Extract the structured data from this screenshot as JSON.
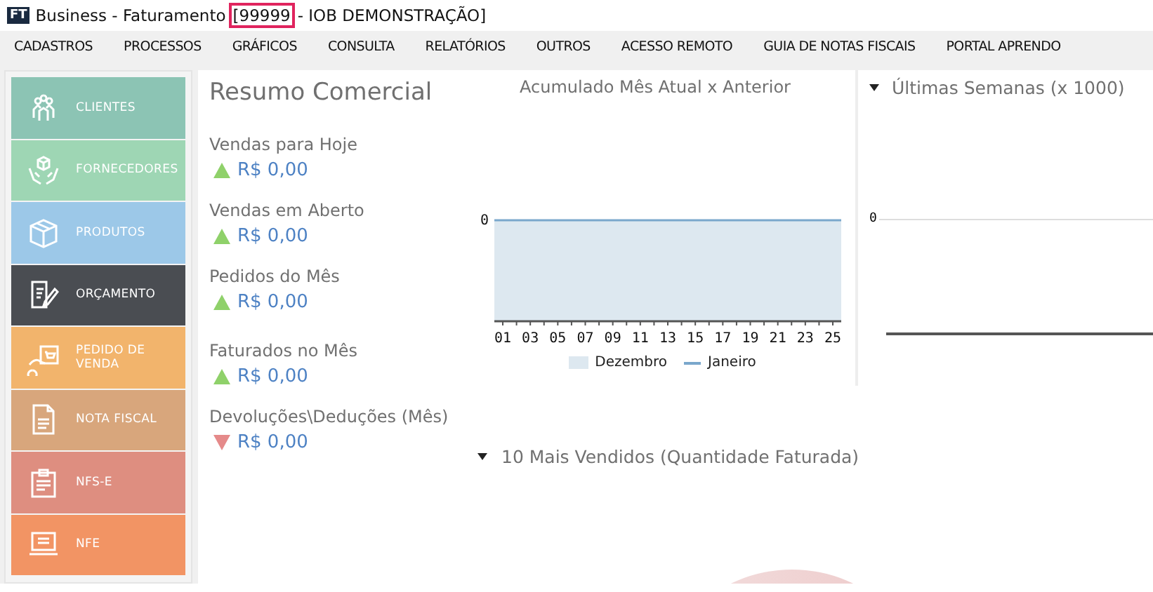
{
  "window": {
    "logo": "FT",
    "title": "Business - Faturamento",
    "code": "[99999",
    "code_highlighted": true,
    "suffix": "- IOB DEMONSTRAÇÃO]"
  },
  "menu": [
    "CADASTROS",
    "PROCESSOS",
    "GRÁFICOS",
    "CONSULTA",
    "RELATÓRIOS",
    "OUTROS",
    "ACESSO REMOTO",
    "GUIA DE NOTAS FISCAIS",
    "PORTAL APRENDO"
  ],
  "sidebar": {
    "items": [
      {
        "label": "CLIENTES",
        "kind": "people",
        "color": "#8cc4b4"
      },
      {
        "label": "FORNECEDORES",
        "kind": "hands",
        "color": "#9ed6b4"
      },
      {
        "label": "PRODUTOS",
        "kind": "box",
        "color": "#9cc8e8"
      },
      {
        "label": "ORÇAMENTO",
        "kind": "document-pen",
        "color": "#4a4d52"
      },
      {
        "label": "PEDIDO DE VENDA",
        "kind": "cart",
        "color": "#f2b46c"
      },
      {
        "label": "NOTA FISCAL",
        "kind": "document",
        "color": "#d8a67c"
      },
      {
        "label": "NFS-E",
        "kind": "clipboard",
        "color": "#de8e80"
      },
      {
        "label": "NFE",
        "kind": "laptop",
        "color": "#f29464"
      }
    ]
  },
  "summary": {
    "title": "Resumo Comercial",
    "metrics": [
      {
        "label": "Vendas para Hoje",
        "value": "R$ 0,00",
        "trend_up": true
      },
      {
        "label": "Vendas em Aberto",
        "value": "R$ 0,00",
        "trend_up": true
      },
      {
        "label": "Pedidos do Mês",
        "value": "R$ 0,00",
        "trend_up": true
      },
      {
        "label": "Faturados no Mês",
        "value": "R$ 0,00",
        "trend_up": true
      },
      {
        "label": "Devoluções\\Deduções (Mês)",
        "value": "R$ 0,00",
        "trend_up": false
      }
    ]
  },
  "monthly_chart": {
    "title": "Acumulado Mês Atual x Anterior",
    "axis_label": "0",
    "x_labels": [
      "01",
      "03",
      "05",
      "07",
      "09",
      "11",
      "13",
      "15",
      "17",
      "19",
      "21",
      "23",
      "25"
    ],
    "legend": [
      {
        "name": "Dezembro",
        "kind": "area",
        "color": "#dde8f0"
      },
      {
        "name": "Janeiro",
        "kind": "line",
        "color": "#7aa7cc"
      }
    ]
  },
  "weeks_panel": {
    "title": "Últimas Semanas (x 1000)",
    "axis_label": "0"
  },
  "top_sellers_panel": {
    "title": "10 Mais Vendidos (Quantidade Faturada)"
  }
}
